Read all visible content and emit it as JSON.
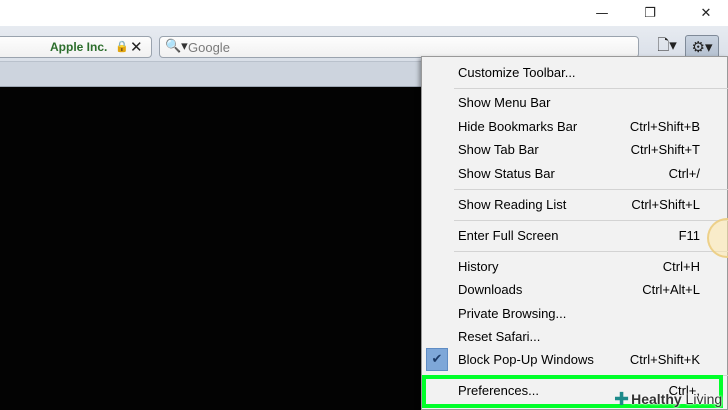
{
  "window": {
    "minimize_glyph": "—",
    "restore_glyph": "❐",
    "close_glyph": "✕"
  },
  "toolbar": {
    "address": {
      "site_label": "Apple Inc.",
      "lock_icon": "lock-icon",
      "clear_glyph": "✕"
    },
    "search": {
      "placeholder": "Google",
      "icon_glyph": "🔍▾"
    },
    "page_button_glyph": "🗋▾",
    "gear_button_glyph": "⚙▾"
  },
  "menu": {
    "items": [
      {
        "label": "Customize Toolbar...",
        "shortcut": ""
      },
      {
        "label": "Show Menu Bar",
        "shortcut": ""
      },
      {
        "label": "Hide Bookmarks Bar",
        "shortcut": "Ctrl+Shift+B"
      },
      {
        "label": "Show Tab Bar",
        "shortcut": "Ctrl+Shift+T"
      },
      {
        "label": "Show Status Bar",
        "shortcut": "Ctrl+/"
      },
      {
        "label": "Show Reading List",
        "shortcut": "Ctrl+Shift+L"
      },
      {
        "label": "Enter Full Screen",
        "shortcut": "F11"
      },
      {
        "label": "History",
        "shortcut": "Ctrl+H"
      },
      {
        "label": "Downloads",
        "shortcut": "Ctrl+Alt+L"
      },
      {
        "label": "Private Browsing...",
        "shortcut": ""
      },
      {
        "label": "Reset Safari...",
        "shortcut": ""
      },
      {
        "label": "Block Pop-Up Windows",
        "shortcut": "Ctrl+Shift+K",
        "checked": true
      },
      {
        "label": "Preferences...",
        "shortcut": "Ctrl+,"
      }
    ],
    "check_glyph": "✔"
  },
  "highlight_color": "#00ff2a",
  "watermark": {
    "plus": "✚",
    "text_bold": "Healthy",
    "text_light": " Living"
  }
}
